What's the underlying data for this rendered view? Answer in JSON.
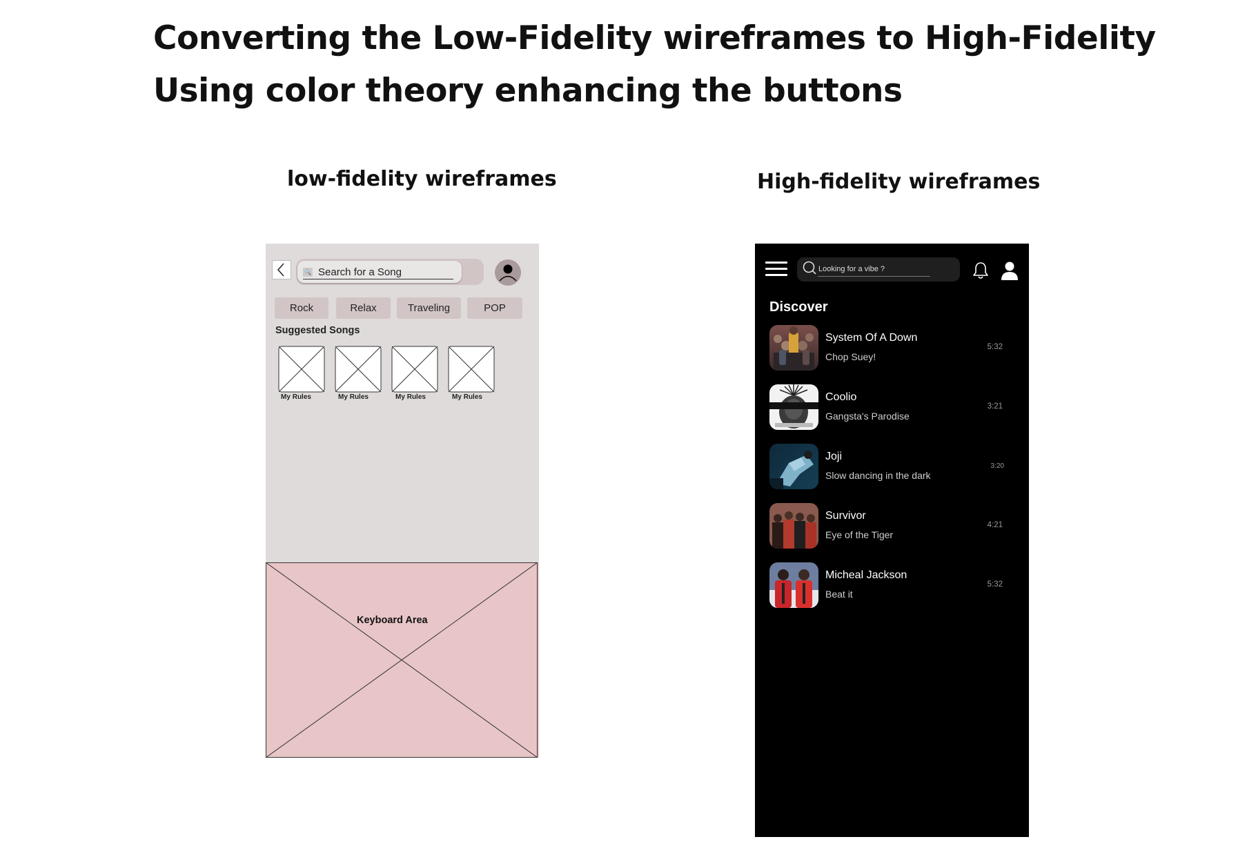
{
  "headings": {
    "line1": "Converting the Low-Fidelity wireframes to High-Fidelity",
    "line2": "Using color theory enhancing the buttons"
  },
  "lofi": {
    "title": "low-fidelity wireframes",
    "search_placeholder": "Search for a Song",
    "tags": [
      "Rock",
      "Relax",
      "Traveling",
      "POP"
    ],
    "suggested_title": "Suggested Songs",
    "thumb_labels": [
      "My Rules",
      "My Rules",
      "My Rules",
      "My Rules"
    ],
    "keyboard_label": "Keyboard Area"
  },
  "hifi": {
    "title": "High-fidelity wireframes",
    "search_placeholder": "Looking for a vibe ?",
    "section_title": "Discover",
    "songs": [
      {
        "artist": "System Of A Down",
        "song": "Chop Suey!",
        "duration": "5:32"
      },
      {
        "artist": "Coolio",
        "song": "Gangsta's Parodise",
        "duration": "3:21"
      },
      {
        "artist": "Joji",
        "song": "Slow dancing in the dark",
        "duration": "3:20"
      },
      {
        "artist": "Survivor",
        "song": "Eye of the Tiger",
        "duration": "4:21"
      },
      {
        "artist": "Micheal Jackson",
        "song": "Beat it",
        "duration": "5:32"
      }
    ]
  },
  "colors": {
    "lofi_background": "#e0dbdb",
    "lofi_button": "#d2c5c6",
    "lofi_keyboard": "#e8c5c7",
    "hifi_background": "#000000",
    "hifi_search": "#1f1f1f"
  },
  "icons": {
    "lofi": [
      "back-arrow-icon",
      "search-icon",
      "avatar-icon",
      "image-placeholder-icon"
    ],
    "hifi": [
      "hamburger-menu-icon",
      "search-icon",
      "bell-icon",
      "user-icon"
    ]
  }
}
